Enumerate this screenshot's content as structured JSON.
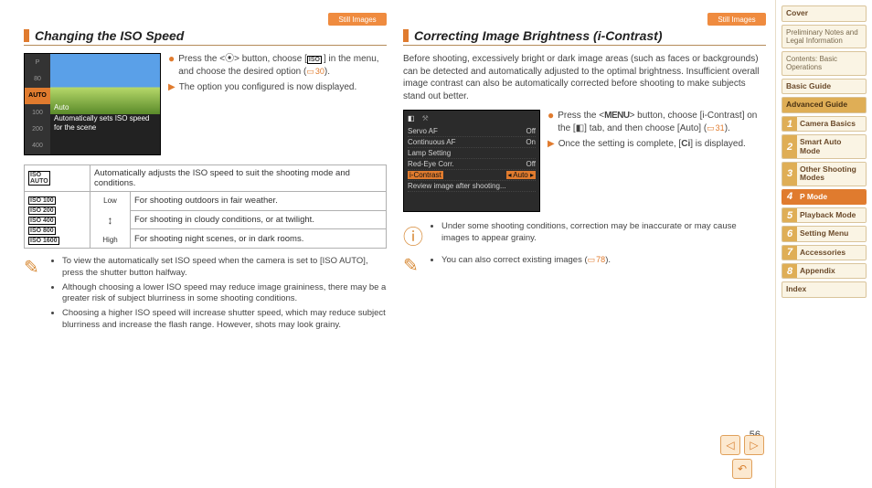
{
  "tags": {
    "still": "Still Images"
  },
  "left": {
    "heading": "Changing the ISO Speed",
    "lcd": {
      "items": [
        "P",
        "80",
        "AUTO",
        "100",
        "200",
        "400"
      ],
      "selected_index": 2,
      "label": "Auto",
      "caption": "Automatically sets ISO speed for the scene"
    },
    "steps": {
      "s1a": "Press the <",
      "s1b": "> button, choose [",
      "s1c": "] in the menu, and choose the desired option (",
      "ref1": "30",
      "s1d": ").",
      "s2": "The option you configured is now displayed."
    },
    "table": {
      "row_auto_label": "ISO AUTO",
      "row_auto_text": "Automatically adjusts the ISO speed to suit the shooting mode and conditions.",
      "labels_group": [
        "ISO 100",
        "ISO 200",
        "ISO 400",
        "ISO 800",
        "ISO 1600"
      ],
      "scale_low": "Low",
      "scale_high": "High",
      "r1": "For shooting outdoors in fair weather.",
      "r2": "For shooting in cloudy conditions, or at twilight.",
      "r3": "For shooting night scenes, or in dark rooms."
    },
    "notes": [
      "To view the automatically set ISO speed when the camera is set to [ISO AUTO], press the shutter button halfway.",
      "Although choosing a lower ISO speed may reduce image graininess, there may be a greater risk of subject blurriness in some shooting conditions.",
      "Choosing a higher ISO speed will increase shutter speed, which may reduce subject blurriness and increase the flash range. However, shots may look grainy."
    ]
  },
  "right": {
    "heading": "Correcting Image Brightness (i-Contrast)",
    "intro": "Before shooting, excessively bright or dark image areas (such as faces or backgrounds) can be detected and automatically adjusted to the optimal brightness. Insufficient overall image contrast can also be automatically corrected before shooting to make subjects stand out better.",
    "lcd": {
      "tabs": [
        "📷",
        "🔧"
      ],
      "rows": [
        [
          "Servo AF",
          "Off"
        ],
        [
          "Continuous AF",
          "On"
        ],
        [
          "Lamp Setting",
          ""
        ],
        [
          "Red-Eye Corr.",
          "Off"
        ],
        [
          "i-Contrast",
          "Auto"
        ],
        [
          "Review image after shooting...",
          ""
        ]
      ],
      "hl_index": 4
    },
    "steps": {
      "s1a": "Press the <",
      "menu": "MENU",
      "s1b": "> button, choose [i-Contrast] on the [",
      "s1c": "] tab, and then choose [Auto] (",
      "ref1": "31",
      "s1d": ").",
      "s2a": "Once the setting is complete, [",
      "s2b": "] is displayed."
    },
    "warn": "Under some shooting conditions, correction may be inaccurate or may cause images to appear grainy.",
    "note_a": "You can also correct existing images (",
    "note_ref": "78",
    "note_b": ")."
  },
  "sidebar": {
    "top": [
      "Cover",
      "Preliminary Notes and Legal Information",
      "Contents: Basic Operations",
      "Basic Guide"
    ],
    "adv": "Advanced Guide",
    "items": [
      {
        "n": "1",
        "l": "Camera Basics"
      },
      {
        "n": "2",
        "l": "Smart Auto Mode"
      },
      {
        "n": "3",
        "l": "Other Shooting Modes"
      },
      {
        "n": "4",
        "l": "P Mode"
      },
      {
        "n": "5",
        "l": "Playback Mode"
      },
      {
        "n": "6",
        "l": "Setting Menu"
      },
      {
        "n": "7",
        "l": "Accessories"
      },
      {
        "n": "8",
        "l": "Appendix"
      }
    ],
    "active_index": 3,
    "index": "Index"
  },
  "page_number": "56",
  "nav": {
    "prev": "◁",
    "next": "▷",
    "return": "↶"
  }
}
